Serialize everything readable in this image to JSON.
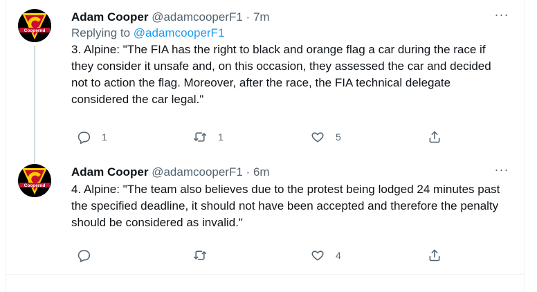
{
  "tweets": [
    {
      "author": {
        "name": "Adam Cooper",
        "handle": "@adamcooperF1",
        "avatar_text": "Coopernd"
      },
      "separator": "·",
      "time": "7m",
      "more": "···",
      "replying_label": "Replying to",
      "replying_handle": "@adamcooperF1",
      "text": "3. Alpine: \"The FIA has the right to black and orange flag a car during the race if they consider it unsafe and, on this occasion, they assessed the car and decided not to action the flag. Moreover, after the race, the FIA technical delegate considered the car legal.\"",
      "counts": {
        "reply": "1",
        "retweet": "1",
        "like": "5"
      }
    },
    {
      "author": {
        "name": "Adam Cooper",
        "handle": "@adamcooperF1",
        "avatar_text": "Coopernd"
      },
      "separator": "·",
      "time": "6m",
      "more": "···",
      "text": "4. Alpine: \"The team also believes due to the protest being lodged 24 minutes past the specified deadline, it should not have been accepted and therefore the penalty should be considered as invalid.\"",
      "counts": {
        "reply": "",
        "retweet": "",
        "like": "4"
      }
    }
  ],
  "icons": [
    "reply-icon",
    "retweet-icon",
    "like-icon",
    "share-icon",
    "more-icon"
  ],
  "colors": {
    "link": "#1d9bf0",
    "secondary": "#536471",
    "text": "#0f1419",
    "avatar_red": "#c8102e",
    "avatar_yellow": "#ffcc00"
  }
}
